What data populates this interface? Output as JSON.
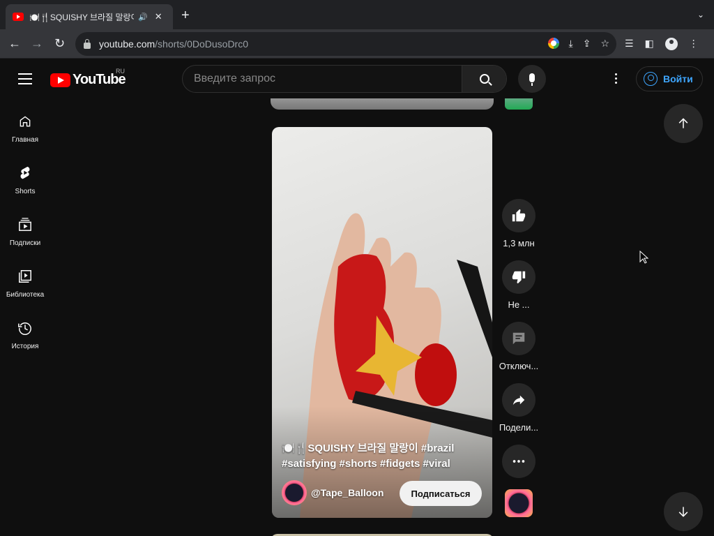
{
  "browser": {
    "tab": {
      "title": "🍽️🍴SQUISHY 브라질 말랑이 #brazil",
      "audio_icon": "speaker-icon"
    },
    "address": {
      "host": "youtube.com",
      "path": "/shorts/0DoDusoDrc0"
    }
  },
  "youtube": {
    "logo_text": "YouTube",
    "region": "RU",
    "search_placeholder": "Введите запрос",
    "sign_in_label": "Войти",
    "sidebar": [
      {
        "label": "Главная",
        "icon": "home-icon"
      },
      {
        "label": "Shorts",
        "icon": "shorts-icon"
      },
      {
        "label": "Подписки",
        "icon": "subscriptions-icon"
      },
      {
        "label": "Библиотека",
        "icon": "library-icon"
      },
      {
        "label": "История",
        "icon": "history-icon"
      }
    ],
    "short": {
      "caption": "🍽️🍴SQUISHY 브라질 말랑이 #brazil #satisfying #shorts #fidgets #viral",
      "channel": "@Tape_Balloon",
      "subscribe_label": "Подписаться"
    },
    "actions": {
      "likes": "1,3 млн",
      "dislike": "Не ...",
      "comments": "Отключ...",
      "share": "Подели..."
    }
  },
  "colors": {
    "background": "#0f0f0f",
    "brand_red": "#ff0000",
    "link_blue": "#3ea6ff",
    "button_dark": "#272727"
  }
}
